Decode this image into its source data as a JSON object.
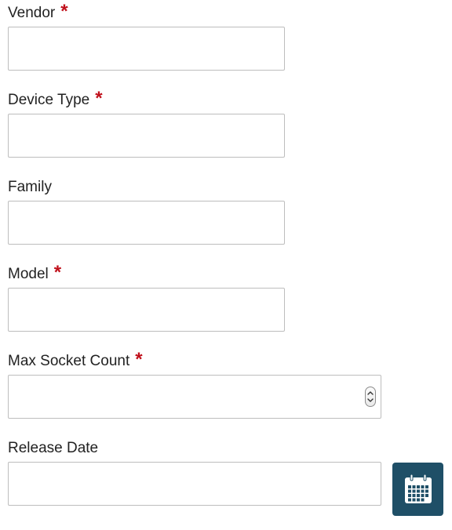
{
  "form": {
    "fields": [
      {
        "label": "Vendor",
        "required_mark": "*",
        "value": ""
      },
      {
        "label": "Device Type",
        "required_mark": "*",
        "value": ""
      },
      {
        "label": "Family",
        "value": ""
      },
      {
        "label": "Model",
        "required_mark": "*",
        "value": ""
      },
      {
        "label": "Max Socket Count",
        "required_mark": "*",
        "value": ""
      },
      {
        "label": "Release Date",
        "value": ""
      }
    ]
  },
  "icons": {
    "spinner": "up-down-stepper-icon",
    "calendar": "calendar-icon"
  },
  "colors": {
    "required_mark": "#c0101b",
    "calendar_button": "#1f4f67",
    "input_border": "#bdbdbd"
  }
}
